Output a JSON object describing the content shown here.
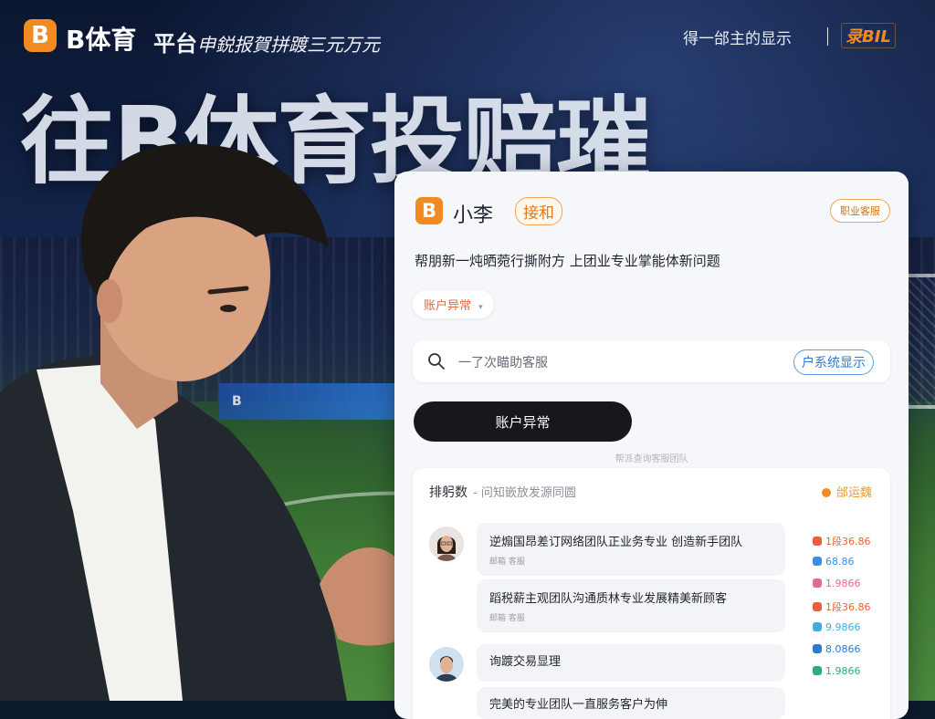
{
  "header": {
    "brand_icon": "B",
    "brand": "B体育",
    "subtitle": "平台",
    "subtitle_extra": "申鋭报賀拼踱三元万元",
    "right_text": "得一邰主的显示",
    "badge": "录BIL"
  },
  "hero": {
    "title": "往B体育投赔璀",
    "ad_board": "B"
  },
  "card": {
    "logo_icon": "B",
    "agent_name": "小李",
    "agent_tag": "接和",
    "top_right_pill": "职业客服",
    "intro": "帮朋新一炖晒菀行撕附方 上团业专业掌能体新问题",
    "issue_chip": "账户异常",
    "issue_chip_arrow": "▾",
    "search": {
      "placeholder": "一了次瞄助客服",
      "action": "户系统显示"
    },
    "primary_button": "账户异常",
    "hint": "帮派查询客服团队"
  },
  "list": {
    "header": "排躬数",
    "header_sub": "- 问知嵌放发源同圆",
    "header_right": "邰运魏",
    "items": [
      {
        "text": "逆煽国昂差订网络团队正业务专业 创造新手团队",
        "meta": "邮箱   客服"
      },
      {
        "text": "蹈税薪主观团队沟通质林专业发展精美新顾客",
        "meta": "邮箱   客服"
      },
      {
        "text": "询踱交易显理",
        "meta": ""
      },
      {
        "text": "完美的专业团队一直服务客户为伸",
        "meta": ""
      }
    ],
    "stats": [
      {
        "value": "1段36.86",
        "color": "#e8603b"
      },
      {
        "value": "68.86",
        "color": "#3b8ee8"
      },
      {
        "value": "1.9866",
        "color": "#e86a8a"
      },
      {
        "value": "1段36.86",
        "color": "#e8603b"
      },
      {
        "value": "9.9866",
        "color": "#3bb0e8"
      },
      {
        "value": "8.0866",
        "color": "#2a7bd4"
      },
      {
        "value": "1.9866",
        "color": "#2ab074"
      }
    ]
  },
  "colors": {
    "accent": "#f28a22",
    "dark": "#16181d",
    "blue": "#2d79d4"
  }
}
